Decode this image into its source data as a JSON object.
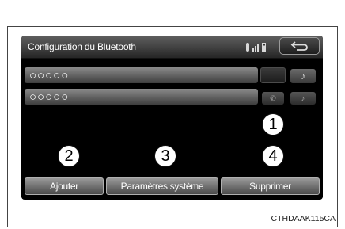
{
  "header": {
    "title": "Configuration du Bluetooth",
    "back_icon": "back-arrow-icon",
    "status_icons": [
      "bluetooth-icon",
      "signal-icon",
      "battery-icon"
    ]
  },
  "devices": [
    {
      "name": "○○○○○"
    },
    {
      "name": "○○○○○"
    }
  ],
  "device_icons": [
    "music-icon",
    "phone-icon",
    "audio-icon"
  ],
  "callouts": [
    "1",
    "2",
    "3",
    "4"
  ],
  "buttons": {
    "add": "Ajouter",
    "system_settings": "Paramètres système",
    "delete": "Supprimer"
  },
  "figure_code": "CTHDAAK115CA"
}
